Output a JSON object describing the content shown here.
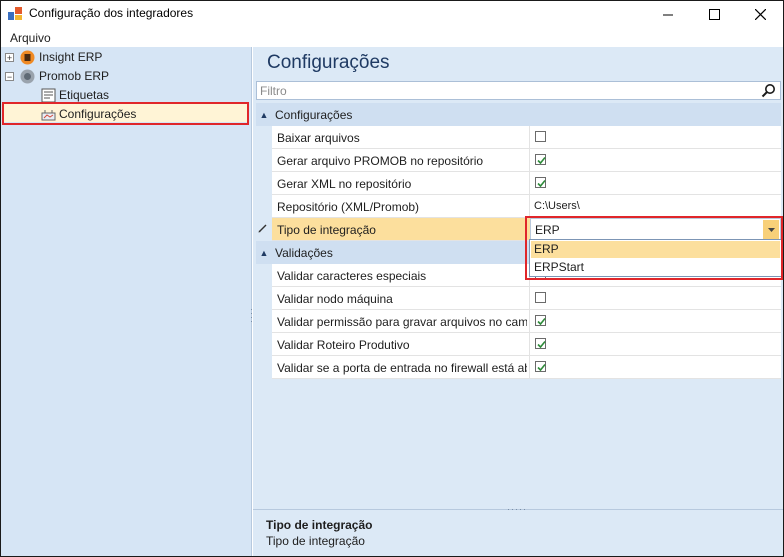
{
  "window": {
    "title": "Configuração dos integradores"
  },
  "menu": {
    "items": [
      "Arquivo"
    ]
  },
  "tree": {
    "nodes": [
      {
        "label": "Insight ERP",
        "expander": "+"
      },
      {
        "label": "Promob ERP",
        "expander": "−"
      },
      {
        "label": "Etiquetas"
      },
      {
        "label": "Configurações"
      }
    ]
  },
  "panel": {
    "title": "Configurações",
    "filter_placeholder": "Filtro"
  },
  "properties": {
    "categories": [
      {
        "label": "Configurações",
        "rows": [
          {
            "name": "Baixar arquivos",
            "checked": false
          },
          {
            "name": "Gerar arquivo PROMOB no repositório",
            "checked": true
          },
          {
            "name": "Gerar XML no repositório",
            "checked": true
          },
          {
            "name": "Repositório (XML/Promob)",
            "value": "C:\\Users\\"
          },
          {
            "name": "Tipo de integração",
            "value": "ERP"
          }
        ]
      },
      {
        "label": "Validações",
        "rows": [
          {
            "name": "Validar caracteres especiais",
            "checked": false
          },
          {
            "name": "Validar nodo máquina",
            "checked": false
          },
          {
            "name": "Validar permissão para gravar arquivos no caminho",
            "checked": true
          },
          {
            "name": "Validar Roteiro Produtivo",
            "checked": true
          },
          {
            "name": "Validar se a porta de entrada no firewall está aberta",
            "checked": true
          }
        ]
      }
    ]
  },
  "dropdown": {
    "options": [
      "ERP",
      "ERPStart"
    ],
    "selected": "ERP"
  },
  "help": {
    "title": "Tipo de integração",
    "description": "Tipo de integração"
  },
  "colors": {
    "highlight": "#fcdf9d",
    "annotation_red": "#e0262a",
    "panel_bg": "#dce9f6"
  }
}
